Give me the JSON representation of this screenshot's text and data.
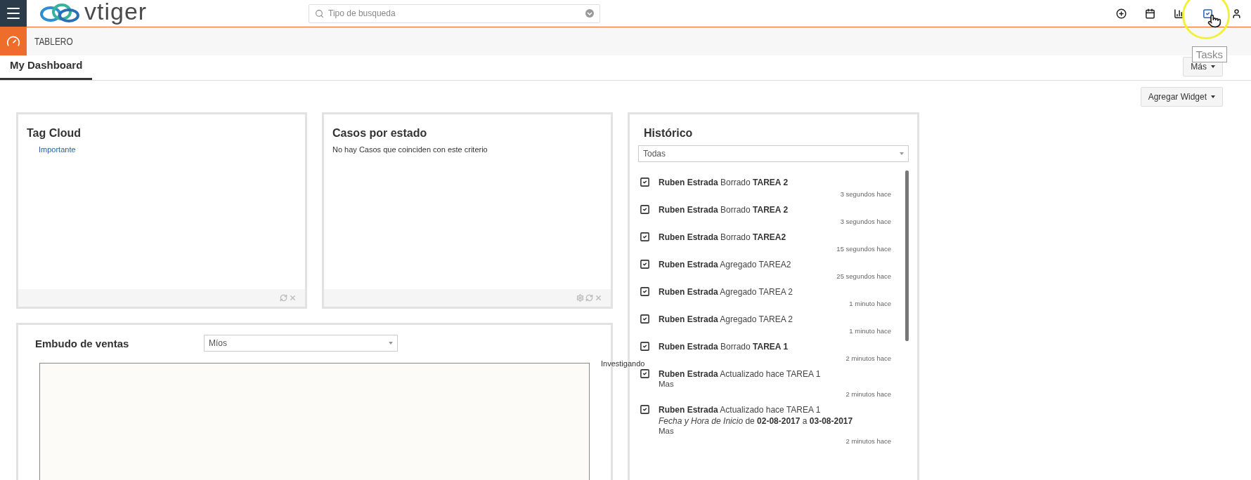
{
  "header": {
    "logo": "vtiger",
    "search": {
      "placeholder": "Tipo de busqueda"
    },
    "icons": [
      {
        "kind": "plus",
        "selected": false
      },
      {
        "kind": "calendar",
        "selected": false
      },
      {
        "kind": "chart",
        "selected": false
      },
      {
        "kind": "tasks",
        "selected": true
      },
      {
        "kind": "user",
        "selected": false
      }
    ],
    "tooltip": "Tasks"
  },
  "module": {
    "title": "TABLERO"
  },
  "tabs": [
    {
      "label": "My Dashboard",
      "selected": true
    }
  ],
  "more_button": "Más",
  "add_widget_button": "Agregar Widget",
  "widgets": [
    {
      "kind": "tags",
      "title": "Tag Cloud",
      "tags": [
        "Importante"
      ]
    },
    {
      "kind": "message",
      "title": "Casos por estado",
      "message": "No hay Casos que coinciden con este criterio"
    }
  ],
  "history": {
    "title": "Histórico",
    "filter": "Todas",
    "items": [
      {
        "text": "**Ruben Estrada** Borrado **TAREA 2**",
        "time": "3 segundos hace"
      },
      {
        "text": "**Ruben Estrada** Borrado **TAREA 2**",
        "time": "3 segundos hace"
      },
      {
        "text": "**Ruben Estrada** Borrado **TAREA2**",
        "time": "15 segundos hace"
      },
      {
        "text": "**Ruben Estrada** Agregado TAREA2",
        "time": "25 segundos hace"
      },
      {
        "text": "**Ruben Estrada** Agregado TAREA 2",
        "time": "1 minuto hace"
      },
      {
        "text": "**Ruben Estrada** Agregado TAREA 2",
        "time": "1 minuto hace"
      },
      {
        "text": "**Ruben Estrada** Borrado **TAREA 1**",
        "time": "2 minutos hace"
      },
      {
        "text": "**Ruben Estrada** Actualizado hace TAREA 1",
        "more": "Mas",
        "time": "2 minutos hace"
      },
      {
        "text": "**Ruben Estrada** Actualizado hace TAREA 1",
        "detail": "*Fecha y Hora de Inicio*  de **02-08-2017** a **03-08-2017**",
        "more": "Mas",
        "time": "2 minutos hace"
      }
    ]
  },
  "funnel": {
    "title": "Embudo de ventas",
    "filter": "Míos",
    "stage_label": "Investigando"
  }
}
